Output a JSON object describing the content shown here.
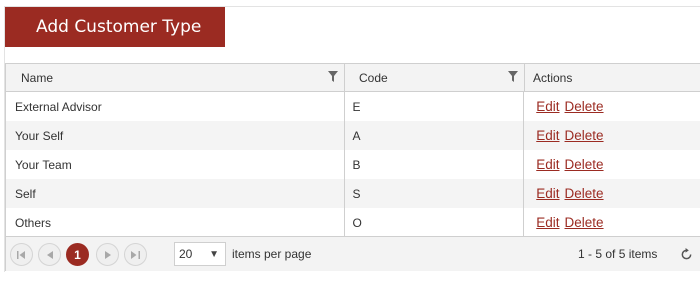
{
  "toolbar": {
    "add_button_label": "Add Customer Type"
  },
  "grid": {
    "columns": [
      {
        "label": "Name",
        "filterable": true
      },
      {
        "label": "Code",
        "filterable": true
      },
      {
        "label": "Actions",
        "filterable": false
      }
    ],
    "rows": [
      {
        "name": "External Advisor",
        "code": "E",
        "edit": "Edit",
        "delete": "Delete"
      },
      {
        "name": "Your Self",
        "code": "A",
        "edit": "Edit",
        "delete": "Delete"
      },
      {
        "name": "Your Team",
        "code": "B",
        "edit": "Edit",
        "delete": "Delete"
      },
      {
        "name": "Self",
        "code": "S",
        "edit": "Edit",
        "delete": "Delete"
      },
      {
        "name": "Others",
        "code": "O",
        "edit": "Edit",
        "delete": "Delete"
      }
    ]
  },
  "pager": {
    "current_page": "1",
    "page_size": "20",
    "items_per_page_label": "items per page",
    "info": "1 - 5 of 5 items",
    "icons": [
      "first-page-icon",
      "prev-page-icon",
      "next-page-icon",
      "last-page-icon",
      "refresh-icon"
    ]
  },
  "colors": {
    "accent": "#9b2b22",
    "header_bg": "#f3f3f3",
    "alt_row_bg": "#f4f4f4"
  }
}
